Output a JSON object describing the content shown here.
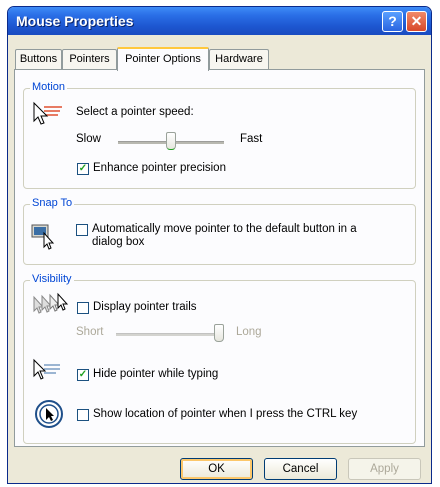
{
  "window": {
    "title": "Mouse Properties",
    "help_glyph": "?",
    "close_glyph": "✕"
  },
  "tabs": [
    "Buttons",
    "Pointers",
    "Pointer Options",
    "Hardware"
  ],
  "active_tab": "Pointer Options",
  "motion": {
    "group_label": "Motion",
    "speed_label": "Select a pointer speed:",
    "slow_label": "Slow",
    "fast_label": "Fast",
    "speed_position": 0.5,
    "enhance_label": "Enhance pointer precision",
    "enhance_checked": true
  },
  "snap_to": {
    "group_label": "Snap To",
    "label_line1": "Automatically move pointer to the default button in a",
    "label_line2": "dialog box",
    "checked": false
  },
  "visibility": {
    "group_label": "Visibility",
    "trails_label": "Display pointer trails",
    "trails_checked": false,
    "short_label": "Short",
    "long_label": "Long",
    "trails_length": 1.0,
    "hide_label": "Hide pointer while typing",
    "hide_checked": true,
    "show_location_label": "Show location of pointer when I press the CTRL key",
    "show_location_checked": false
  },
  "buttons": {
    "ok": "OK",
    "cancel": "Cancel",
    "apply": "Apply"
  },
  "colors": {
    "title_bar": "#2a6ee6",
    "group_title": "#0046d5",
    "check": "#21a121",
    "active_tab_accent": "#ffc83c"
  }
}
